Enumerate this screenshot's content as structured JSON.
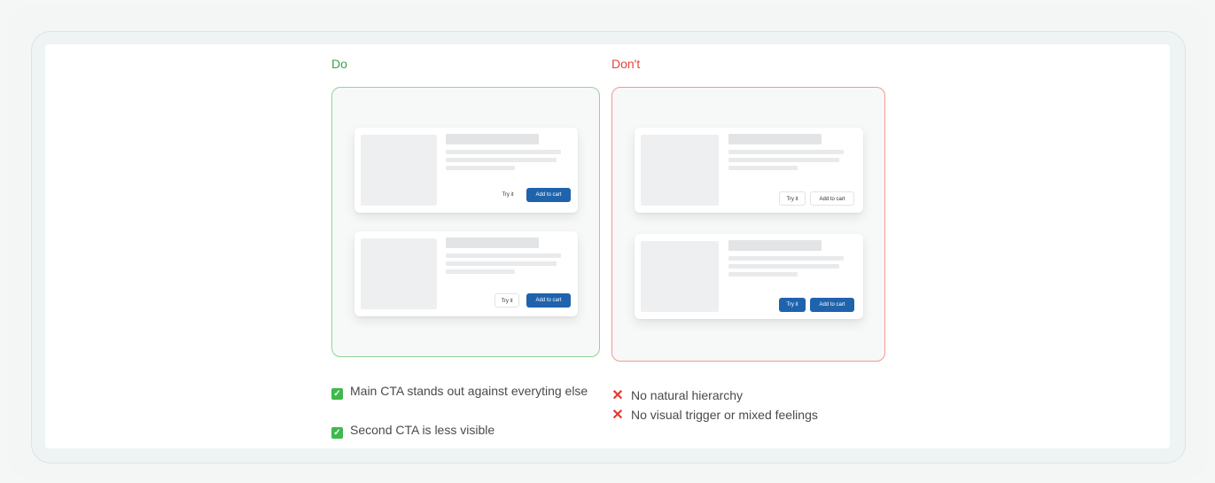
{
  "do": {
    "heading": "Do",
    "cards": [
      {
        "secondary_label": "Try it",
        "primary_label": "Add to cart"
      },
      {
        "secondary_label": "Try it",
        "primary_label": "Add to cart"
      }
    ],
    "notes": [
      "Main CTA stands out against everyting else",
      "Second CTA is less visible"
    ]
  },
  "dont": {
    "heading": "Don't",
    "cards": [
      {
        "secondary_label": "Try it",
        "primary_label": "Add to cart"
      },
      {
        "secondary_label": "Try it",
        "primary_label": "Add to cart"
      }
    ],
    "notes": [
      "No natural hierarchy",
      "No visual trigger or mixed feelings"
    ]
  },
  "icons": {
    "do_note": "check-icon",
    "dont_note": "cross-icon"
  },
  "colors": {
    "do_accent": "#3aa24a",
    "dont_accent": "#e2433b",
    "primary_button": "#1f63ad"
  }
}
